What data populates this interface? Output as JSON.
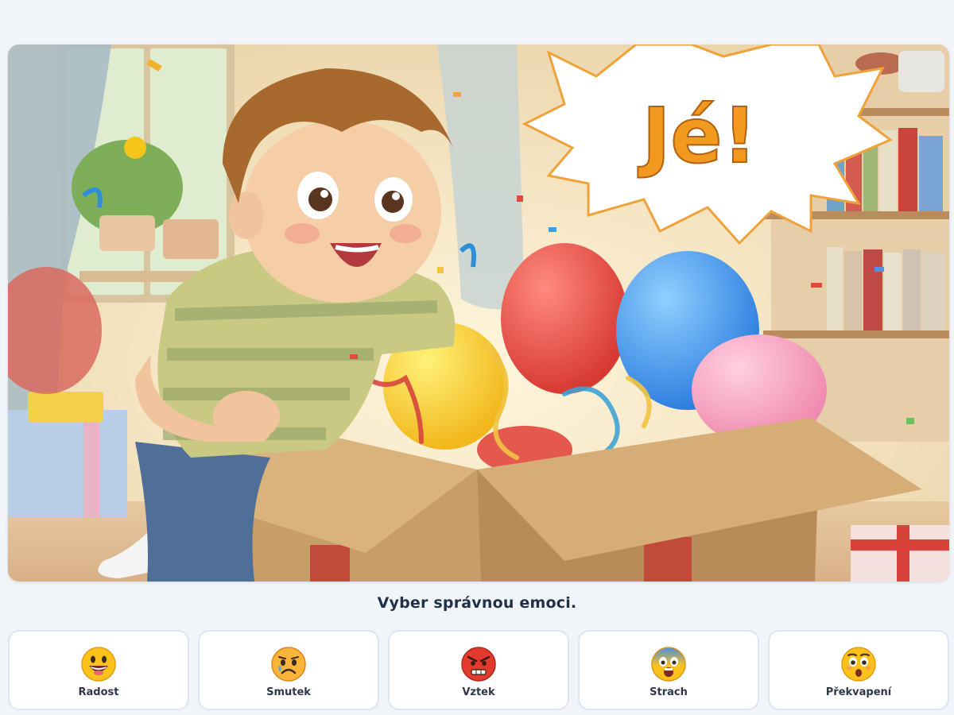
{
  "illustration": {
    "speech_bubble_text": "Jé!",
    "description_icon": "surprised-boy-opening-gift-box"
  },
  "question": {
    "prompt": "Vyber správnou emoci."
  },
  "choices": [
    {
      "label": "Radost",
      "icon": "grinning-face-icon",
      "color": "#fcc21b"
    },
    {
      "label": "Smutek",
      "icon": "sad-face-icon",
      "color": "#fbb43a"
    },
    {
      "label": "Vztek",
      "icon": "angry-face-icon",
      "color": "#e23b2e"
    },
    {
      "label": "Strach",
      "icon": "fearful-face-icon",
      "color": "#4a8fe0"
    },
    {
      "label": "Překvapení",
      "icon": "astonished-face-icon",
      "color": "#fcc21b"
    }
  ],
  "colors": {
    "background": "#f1f5fa",
    "bubble_text": "#f29a1f",
    "card_border": "#dde5f0",
    "prompt_text": "#223047"
  }
}
